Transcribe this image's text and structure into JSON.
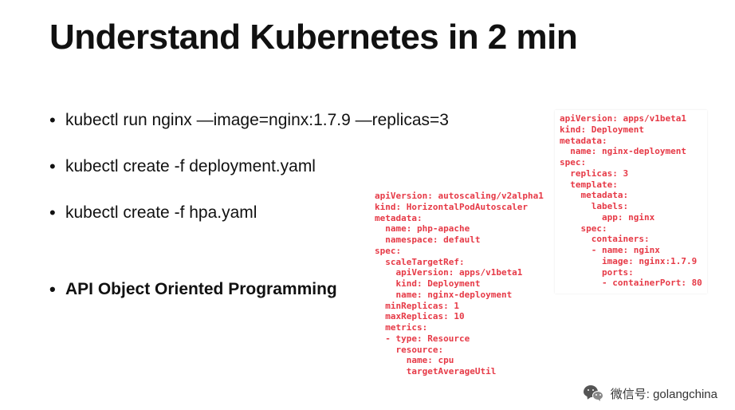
{
  "title": "Understand Kubernetes in 2 min",
  "bullets": [
    {
      "text": "kubectl run nginx —image=nginx:1.7.9 —replicas=3",
      "bold": false
    },
    {
      "text": "kubectl create -f deployment.yaml",
      "bold": false
    },
    {
      "text": "kubectl create -f hpa.yaml",
      "bold": false
    },
    {
      "text": "",
      "bold": false,
      "spacer": true
    },
    {
      "text": "API Object Oriented Programming",
      "bold": true
    }
  ],
  "yaml_hpa": "apiVersion: autoscaling/v2alpha1\nkind: HorizontalPodAutoscaler\nmetadata:\n  name: php-apache\n  namespace: default\nspec:\n  scaleTargetRef:\n    apiVersion: apps/v1beta1\n    kind: Deployment\n    name: nginx-deployment\n  minReplicas: 1\n  maxReplicas: 10\n  metrics:\n  - type: Resource\n    resource:\n      name: cpu\n      targetAverageUtil",
  "yaml_deployment": "apiVersion: apps/v1beta1\nkind: Deployment\nmetadata:\n  name: nginx-deployment\nspec:\n  replicas: 3\n  template:\n    metadata:\n      labels:\n        app: nginx\n    spec:\n      containers:\n      - name: nginx\n        image: nginx:1.7.9\n        ports:\n        - containerPort: 80",
  "footer": {
    "label": "微信号: golangchina"
  }
}
